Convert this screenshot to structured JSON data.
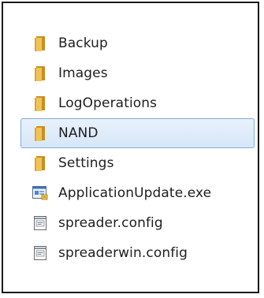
{
  "files": [
    {
      "name": "Backup",
      "icon": "folder-icon",
      "selected": false
    },
    {
      "name": "Images",
      "icon": "folder-icon",
      "selected": false
    },
    {
      "name": "LogOperations",
      "icon": "folder-icon",
      "selected": false
    },
    {
      "name": "NAND",
      "icon": "folder-icon",
      "selected": true
    },
    {
      "name": "Settings",
      "icon": "folder-icon",
      "selected": false
    },
    {
      "name": "ApplicationUpdate.exe",
      "icon": "executable-icon",
      "selected": false
    },
    {
      "name": "spreader.config",
      "icon": "config-file-icon",
      "selected": false
    },
    {
      "name": "spreaderwin.config",
      "icon": "config-file-icon",
      "selected": false
    }
  ],
  "colors": {
    "folder": "#e8b84a",
    "folder_dark": "#c98f1e",
    "selection_fill": "#dbe9f9",
    "selection_border": "#84acdd",
    "text": "#1e1e1e"
  }
}
